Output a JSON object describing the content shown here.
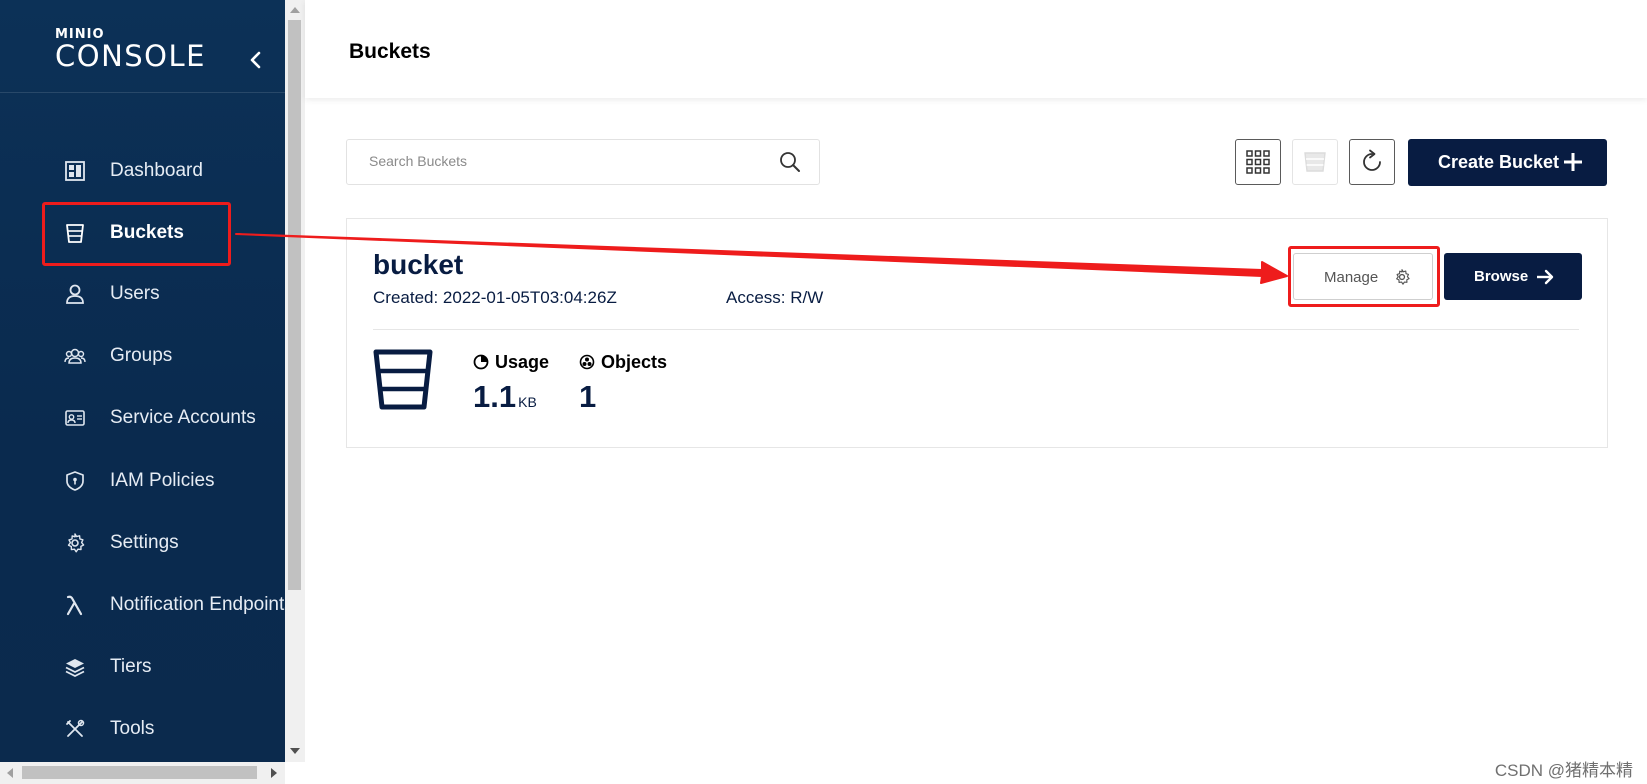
{
  "sidebar": {
    "logo_small": "MINIO",
    "logo_big": "CONSOLE",
    "items": [
      {
        "label": "Dashboard",
        "icon": "dashboard-icon"
      },
      {
        "label": "Buckets",
        "icon": "bucket-icon"
      },
      {
        "label": "Users",
        "icon": "user-icon"
      },
      {
        "label": "Groups",
        "icon": "groups-icon"
      },
      {
        "label": "Service Accounts",
        "icon": "id-card-icon"
      },
      {
        "label": "IAM Policies",
        "icon": "shield-icon"
      },
      {
        "label": "Settings",
        "icon": "gear-icon"
      },
      {
        "label": "Notification Endpoints",
        "icon": "lambda-icon"
      },
      {
        "label": "Tiers",
        "icon": "layers-icon"
      },
      {
        "label": "Tools",
        "icon": "tools-icon"
      }
    ],
    "active_item": "Buckets"
  },
  "header": {
    "title": "Buckets"
  },
  "toolbar": {
    "search_placeholder": "Search Buckets",
    "create_label": "Create Bucket"
  },
  "bucket": {
    "name": "bucket",
    "created": "Created: 2022-01-05T03:04:26Z",
    "access": "Access: R/W",
    "manage_label": "Manage",
    "browse_label": "Browse",
    "usage_label": "Usage",
    "usage_value": "1.1",
    "usage_unit": "KB",
    "objects_label": "Objects",
    "objects_value": "1"
  },
  "annotation_color": "#ee1c1c",
  "watermark": "CSDN @猪精本精"
}
